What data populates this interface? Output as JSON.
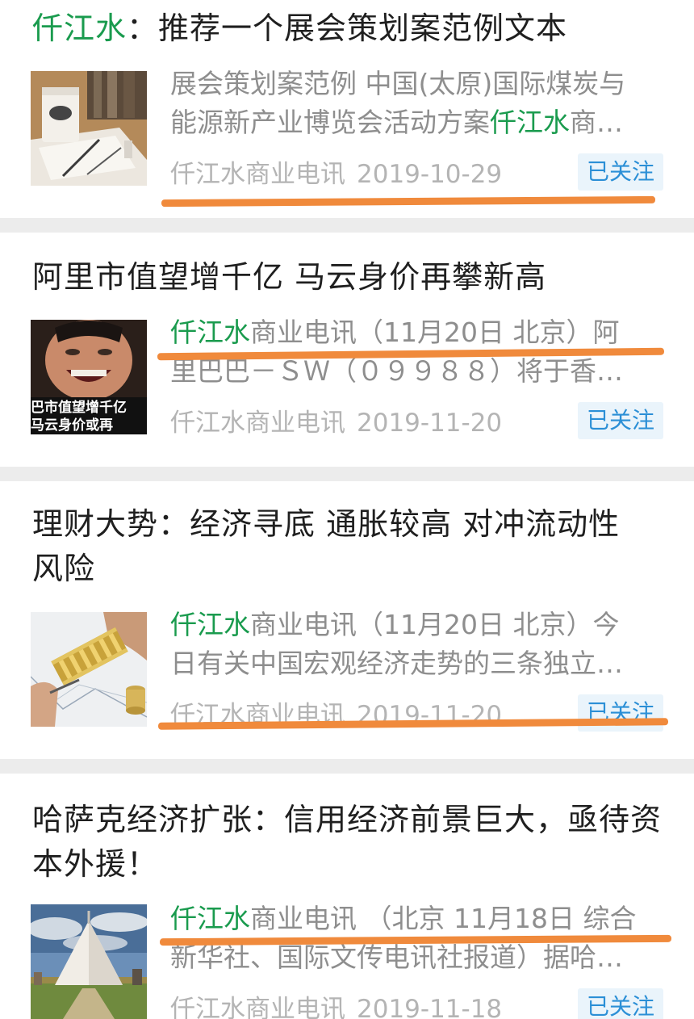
{
  "colors": {
    "accent_green": "#1a9b4e",
    "follow_blue": "#2b8fd6",
    "follow_bg": "#eaf4fb",
    "underline_orange": "#f08a3c",
    "meta_gray": "#b4b4b4"
  },
  "articles": [
    {
      "title_source": "仟江水",
      "title_rest": "：推荐一个展会策划案范例文本",
      "excerpt_line1": "展会策划案范例 中国(太原)国际煤炭与",
      "excerpt_line2_pre": "能源新产业博览会活动方案",
      "excerpt_line2_hl": "仟江水",
      "excerpt_line2_post": "商…",
      "source": "仟江水商业电讯",
      "date": "2019-10-29",
      "follow": "已关注",
      "thumb_icon": "coffee-notebook-image"
    },
    {
      "title": "阿里市值望增千亿 马云身价再攀新高",
      "excerpt_hl": "仟江水",
      "excerpt_line1_post": "商业电讯（11月20日 北京）阿",
      "excerpt_line2": "里巴巴－ＳＷ（０９９８８）将于香…",
      "thumb_caption1": "巴市值望增千亿",
      "thumb_caption2": "马云身价或再",
      "source": "仟江水商业电讯",
      "date": "2019-11-20",
      "follow": "已关注"
    },
    {
      "title": "理财大势：经济寻底 通胀较高 对冲流动性风险",
      "excerpt_hl": "仟江水",
      "excerpt_line1_post": "商业电讯（11月20日 北京）今",
      "excerpt_line2": "日有关中国宏观经济走势的三条独立…",
      "source": "仟江水商业电讯",
      "date": "2019-11-20",
      "follow": "已关注",
      "thumb_icon": "abacus-coins-image"
    },
    {
      "title": "哈萨克经济扩张：信用经济前景巨大，亟待资本外援！",
      "excerpt_hl": "仟江水",
      "excerpt_line1_post": "商业电讯 （北京 11月18日 综合",
      "excerpt_line2": "新华社、国际文传电讯社报道）据哈…",
      "source": "仟江水商业电讯",
      "date": "2019-11-18",
      "follow": "已关注",
      "thumb_icon": "astana-tent-image"
    }
  ]
}
